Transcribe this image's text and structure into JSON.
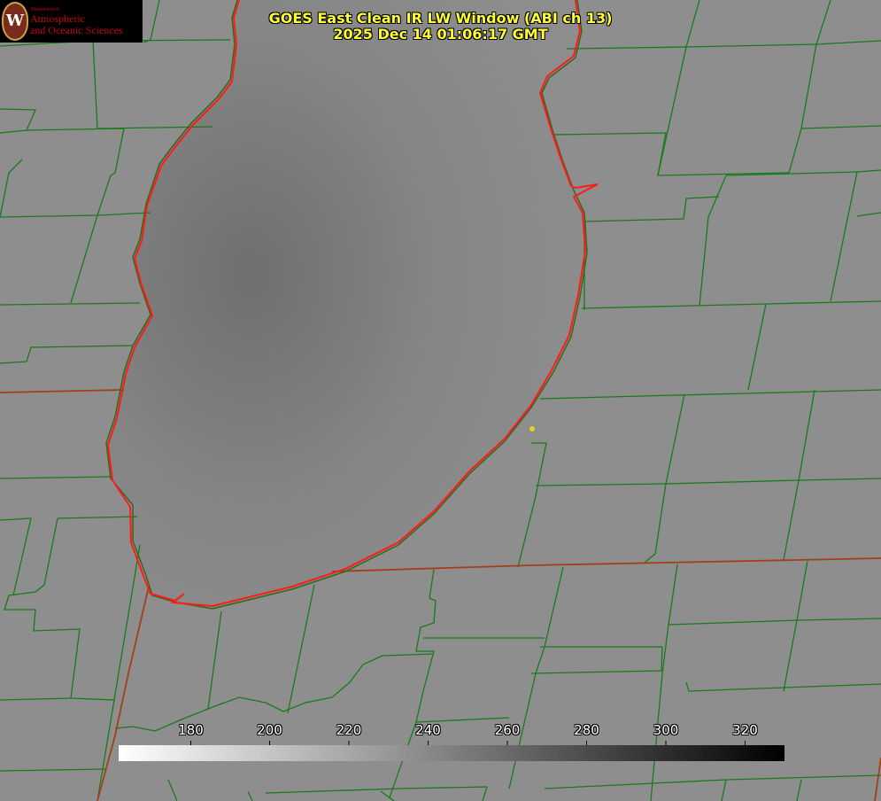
{
  "logo": {
    "department": "Department of",
    "line1": "Atmospheric",
    "line2": "and Oceanic Sciences",
    "seal_letter": "W"
  },
  "title": {
    "line1": "GOES East Clean IR LW Window (ABI ch 13)",
    "line2": "2025 Dec 14 01:06:17 GMT"
  },
  "colorbar": {
    "ticks": [
      "180",
      "200",
      "220",
      "240",
      "260",
      "280",
      "300",
      "320"
    ],
    "range": [
      162,
      330
    ]
  },
  "colors": {
    "county_lines": "#1a7a1a",
    "state_lines": "#a0401a",
    "lake_outline": "#ff1a1a",
    "title_text": "#ffff33",
    "marker": "#e6d21e"
  }
}
